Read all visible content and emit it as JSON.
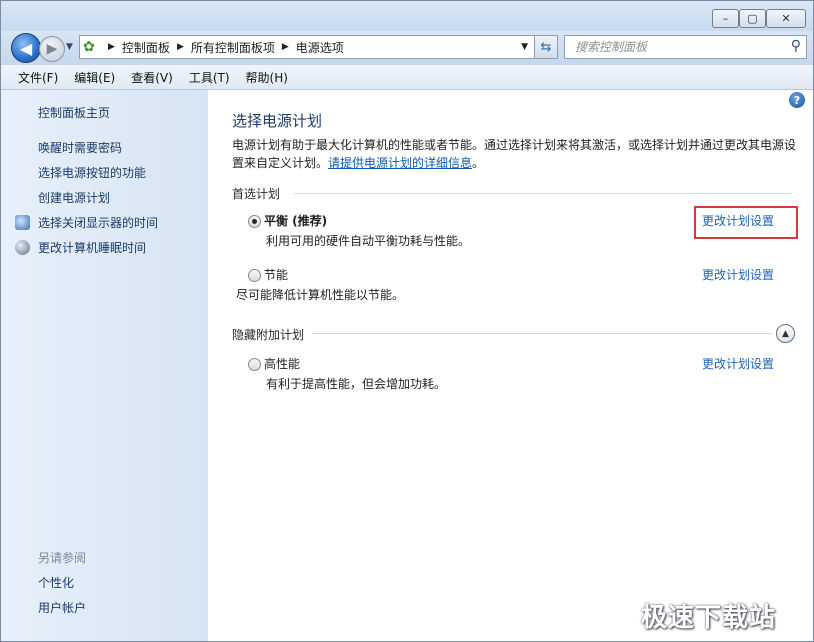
{
  "window": {
    "minimize": "–",
    "maximize": "▢",
    "close": "✕"
  },
  "address": {
    "breadcrumbs": [
      "控制面板",
      "所有控制面板项",
      "电源选项"
    ],
    "search_placeholder": "搜索控制面板"
  },
  "menu": [
    "文件(F)",
    "编辑(E)",
    "查看(V)",
    "工具(T)",
    "帮助(H)"
  ],
  "sidebar": {
    "home": "控制面板主页",
    "links": [
      "唤醒时需要密码",
      "选择电源按钮的功能",
      "创建电源计划",
      "选择关闭显示器的时间",
      "更改计算机睡眠时间"
    ],
    "see_also": "另请参阅",
    "see_also_links": [
      "个性化",
      "用户帐户"
    ]
  },
  "main": {
    "title": "选择电源计划",
    "description": "电源计划有助于最大化计算机的性能或者节能。通过选择计划来将其激活，或选择计划并通过更改其电源设置来自定义计划。",
    "details_link": "请提供电源计划的详细信息",
    "preferred_label": "首选计划",
    "hidden_label": "隐藏附加计划",
    "plans": [
      {
        "name": "平衡 (推荐)",
        "desc": "利用可用的硬件自动平衡功耗与性能。",
        "link": "更改计划设置",
        "selected": true
      },
      {
        "name": "节能",
        "desc": "尽可能降低计算机性能以节能。",
        "link": "更改计划设置",
        "selected": false
      },
      {
        "name": "高性能",
        "desc": "有利于提高性能，但会增加功耗。",
        "link": "更改计划设置",
        "selected": false
      }
    ]
  },
  "watermark": "极速下载站"
}
